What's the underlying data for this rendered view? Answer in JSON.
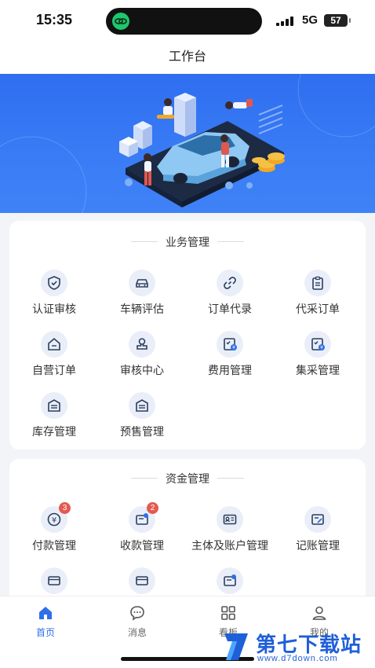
{
  "status_bar": {
    "time": "15:35",
    "network": "5G",
    "battery": "57"
  },
  "page_title": "工作台",
  "business": {
    "title": "业务管理",
    "items": [
      {
        "label": "认证审核",
        "icon": "shield-check-icon"
      },
      {
        "label": "车辆评估",
        "icon": "car-icon"
      },
      {
        "label": "订单代录",
        "icon": "link-icon"
      },
      {
        "label": "代采订单",
        "icon": "clipboard-icon"
      },
      {
        "label": "自营订单",
        "icon": "home-icon"
      },
      {
        "label": "审核中心",
        "icon": "stamp-icon"
      },
      {
        "label": "费用管理",
        "icon": "bill-icon"
      },
      {
        "label": "集采管理",
        "icon": "bill-icon"
      },
      {
        "label": "库存管理",
        "icon": "warehouse-icon"
      },
      {
        "label": "预售管理",
        "icon": "warehouse-icon"
      }
    ]
  },
  "funds": {
    "title": "资金管理",
    "items": [
      {
        "label": "付款管理",
        "icon": "yuan-icon",
        "badge": "3"
      },
      {
        "label": "收款管理",
        "icon": "wallet-icon",
        "badge": "2"
      },
      {
        "label": "主体及账户管理",
        "icon": "id-card-icon"
      },
      {
        "label": "记账管理",
        "icon": "ledger-icon"
      }
    ]
  },
  "tabbar": {
    "items": [
      {
        "label": "首页",
        "icon": "home-icon",
        "active": true
      },
      {
        "label": "消息",
        "icon": "message-icon"
      },
      {
        "label": "看板",
        "icon": "grid-icon"
      },
      {
        "label": "我的",
        "icon": "user-icon"
      }
    ]
  },
  "watermark": {
    "title": "第七下载站",
    "url": "www.d7down.com"
  },
  "colors": {
    "accent": "#2f6fe8",
    "banner": "#3a7cf5",
    "badge": "#e35a4f",
    "icon_bg": "#e9eef9"
  }
}
